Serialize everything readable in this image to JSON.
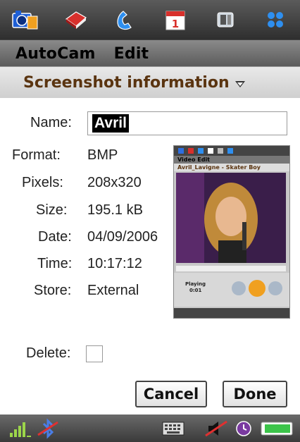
{
  "appbar": {
    "icons": [
      "camera-icon",
      "book-icon",
      "phone-icon",
      "calendar-icon",
      "media-icon",
      "apps-grid-icon"
    ],
    "calendar_day": "1"
  },
  "menu": {
    "items": [
      "AutoCam",
      "Edit"
    ]
  },
  "title": "Screenshot information",
  "fields": {
    "name_label": "Name:",
    "name_value": "Avril",
    "format_label": "Format:",
    "format_value": "BMP",
    "pixels_label": "Pixels:",
    "pixels_value": "208x320",
    "size_label": "Size:",
    "size_value": "195.1 kB",
    "date_label": "Date:",
    "date_value": "04/09/2006",
    "time_label": "Time:",
    "time_value": "10:17:12",
    "store_label": "Store:",
    "store_value": "External",
    "delete_label": "Delete:"
  },
  "thumbnail": {
    "menu": "Video   Edit",
    "title": "Avril_Lavigne - Skater Boy",
    "status": "Playing",
    "time": "0:01"
  },
  "buttons": {
    "cancel": "Cancel",
    "done": "Done"
  },
  "statusbar": {
    "icons": [
      "signal-icon",
      "bluetooth-off-icon",
      "keyboard-icon",
      "silent-icon",
      "alarm-icon",
      "battery-icon"
    ]
  },
  "colors": {
    "title_text": "#5a3410",
    "bar_dark": "#3a3a3a"
  }
}
